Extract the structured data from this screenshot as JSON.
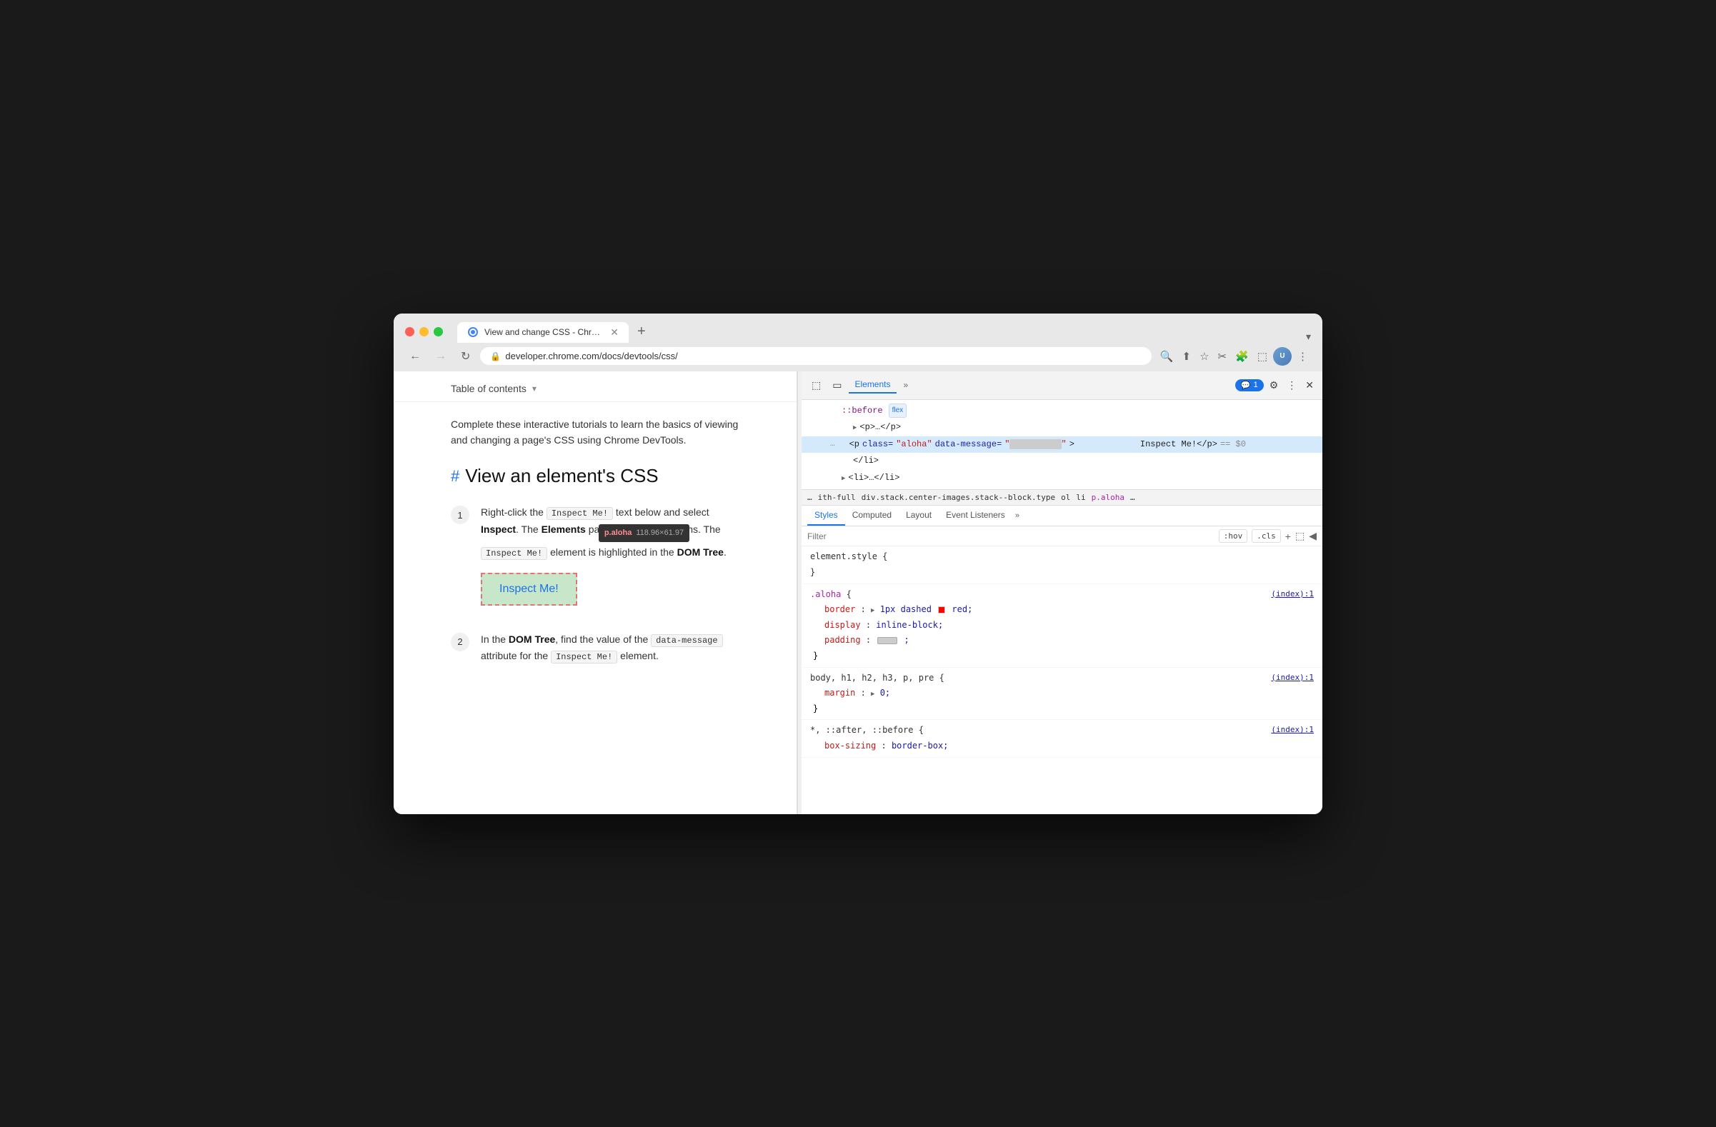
{
  "browser": {
    "title": "View and change CSS - Chrome DevTools",
    "url": "developer.chrome.com/docs/devtools/css/",
    "tab_label": "View and change CSS - Chrom...",
    "new_tab_label": "+",
    "nav": {
      "back": "←",
      "forward": "→",
      "refresh": "↻"
    }
  },
  "page": {
    "toc_label": "Table of contents",
    "toc_arrow": "▾",
    "intro": "Complete these interactive tutorials to learn the basics of viewing and changing a page's CSS using Chrome DevTools.",
    "heading": "View an element's CSS",
    "heading_hash": "#",
    "steps": [
      {
        "num": "1",
        "text_parts": [
          "Right-click the ",
          "Inspect Me!",
          " text below and select ",
          "Inspect",
          ". The ",
          "Elements",
          " panel of DevTools opens. The ",
          "Inspect Me!",
          " element is highlighted in the ",
          "DOM Tree",
          "."
        ]
      },
      {
        "num": "2",
        "text_parts": [
          "In the ",
          "DOM Tree",
          ", find the value of the ",
          "data-message",
          " attribute for the ",
          "Inspect Me!",
          " element."
        ]
      }
    ],
    "tooltip": {
      "tag": "p.aloha",
      "dims": "118.96×61.97"
    },
    "inspect_me_label": "Inspect Me!",
    "step2_inline1": "data-message",
    "step2_inline2": "Inspect Me!"
  },
  "devtools": {
    "tabs": [
      "Elements",
      ">>"
    ],
    "active_tab": "Elements",
    "badge_count": "1",
    "icons": {
      "inspect": "⬚",
      "device": "▭",
      "gear": "⚙",
      "more": "⋮",
      "close": "✕",
      "chat": "💬"
    },
    "dom": {
      "line1": "::before",
      "line1_badge": "flex",
      "line2": "<p>…</p>",
      "line3_start": "<p class=\"aloha\" data-message=\"",
      "line3_redacted": "████████████",
      "line3_end": "\">",
      "line3_content": "Inspect Me!</p>",
      "line3_eq": "== $0",
      "line4": "</li>",
      "line5": "<li>…</li>"
    },
    "breadcrumb": {
      "items": [
        "...",
        "ith-full",
        "div.stack.center-images.stack--block.type",
        "ol",
        "li",
        "p.aloha",
        "..."
      ]
    },
    "styles": {
      "tabs": [
        "Styles",
        "Computed",
        "Layout",
        "Event Listeners",
        ">>"
      ],
      "active_tab": "Styles",
      "filter_placeholder": "Filter",
      "filter_actions": [
        ":hov",
        ".cls"
      ],
      "rules": [
        {
          "selector": "element.style",
          "source": "",
          "props": []
        },
        {
          "selector": ".aloha",
          "source": "(index):1",
          "props": [
            {
              "name": "border",
              "value": "1px dashed  red",
              "has_swatch": true
            },
            {
              "name": "display",
              "value": "inline-block"
            },
            {
              "name": "padding",
              "value": "redacted",
              "has_grey_swatch": true
            }
          ]
        },
        {
          "selector": "body, h1, h2, h3, p, pre",
          "source": "(index):1",
          "props": [
            {
              "name": "margin",
              "value": "0",
              "has_triangle": true
            }
          ]
        },
        {
          "selector": "*, ::after, ::before",
          "source": "(index):1",
          "props": [
            {
              "name": "box-sizing",
              "value": "border-box"
            }
          ]
        }
      ]
    }
  }
}
